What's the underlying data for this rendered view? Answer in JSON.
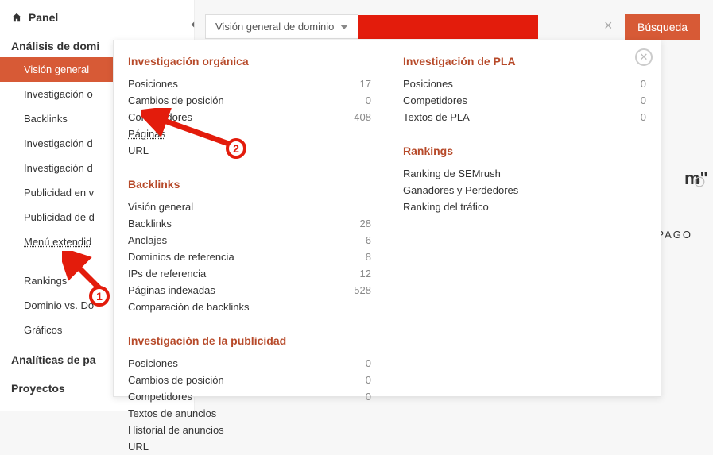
{
  "sidebar": {
    "panel": "Panel",
    "analisis": "Análisis de domi",
    "items": [
      "Visión general",
      "Investigación o",
      "Backlinks",
      "Investigación d",
      "Investigación d",
      "Publicidad en v",
      "Publicidad de d",
      "Menú extendid"
    ],
    "rankings": "Rankings",
    "dominio": "Dominio vs. Do",
    "graficos": "Gráficos",
    "analiticas": "Analíticas de pa",
    "proyectos": "Proyectos"
  },
  "topbar": {
    "domain_dd": "Visión general de dominio",
    "search": "Búsqueda"
  },
  "right": {
    "m": "m\"",
    "pago": "PAGO"
  },
  "popup": {
    "organica": {
      "title": "Investigación orgánica",
      "rows": [
        {
          "label": "Posiciones",
          "value": "17"
        },
        {
          "label": "Cambios de posición",
          "value": "0"
        },
        {
          "label": "Competidores",
          "value": "408"
        },
        {
          "label": "Páginas",
          "value": "",
          "dotted": true
        },
        {
          "label": "URL",
          "value": ""
        }
      ]
    },
    "backlinks": {
      "title": "Backlinks",
      "rows": [
        {
          "label": "Visión general",
          "value": ""
        },
        {
          "label": "Backlinks",
          "value": "28"
        },
        {
          "label": "Anclajes",
          "value": "6"
        },
        {
          "label": "Dominios de referencia",
          "value": "8"
        },
        {
          "label": "IPs de referencia",
          "value": "12"
        },
        {
          "label": "Páginas indexadas",
          "value": "528"
        },
        {
          "label": "Comparación de backlinks",
          "value": ""
        }
      ]
    },
    "publicidad": {
      "title": "Investigación de la publicidad",
      "rows": [
        {
          "label": "Posiciones",
          "value": "0"
        },
        {
          "label": "Cambios de posición",
          "value": "0"
        },
        {
          "label": "Competidores",
          "value": "0"
        },
        {
          "label": "Textos de anuncios",
          "value": ""
        },
        {
          "label": "Historial de anuncios",
          "value": ""
        },
        {
          "label": "URL",
          "value": ""
        }
      ]
    },
    "pla": {
      "title": "Investigación de PLA",
      "rows": [
        {
          "label": "Posiciones",
          "value": "0"
        },
        {
          "label": "Competidores",
          "value": "0"
        },
        {
          "label": "Textos de PLA",
          "value": "0"
        }
      ]
    },
    "rankings": {
      "title": "Rankings",
      "rows": [
        {
          "label": "Ranking de SEMrush",
          "value": ""
        },
        {
          "label": "Ganadores y Perdedores",
          "value": ""
        },
        {
          "label": "Ranking del tráfico",
          "value": ""
        }
      ]
    }
  },
  "annotations": {
    "b1": "1",
    "b2": "2"
  }
}
